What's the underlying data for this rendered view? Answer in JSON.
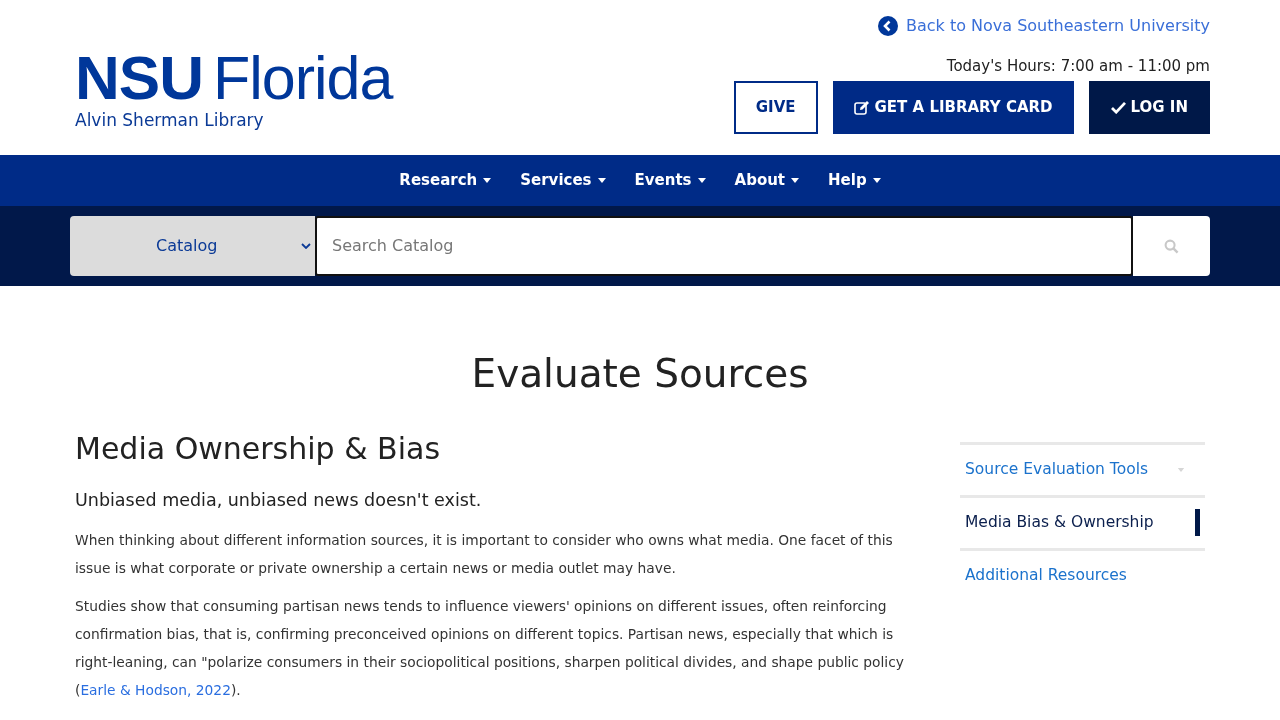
{
  "header": {
    "logo": {
      "primary": "NSU",
      "secondary": "Florida",
      "subtitle": "Alvin Sherman Library"
    },
    "back_link": "Back to Nova Southeastern University",
    "hours": "Today's Hours: 7:00 am - 11:00 pm",
    "buttons": [
      {
        "label": "GIVE",
        "kind": "outline"
      },
      {
        "label": "GET A LIBRARY CARD",
        "kind": "primary"
      },
      {
        "label": "LOG IN",
        "kind": "dark"
      }
    ]
  },
  "nav": {
    "items": [
      {
        "label": "Research"
      },
      {
        "label": "Services"
      },
      {
        "label": "Events"
      },
      {
        "label": "About"
      },
      {
        "label": "Help"
      }
    ]
  },
  "search": {
    "scope": "Catalog",
    "placeholder": "Search Catalog"
  },
  "page_title": "Evaluate Sources",
  "article": {
    "heading": "Media Ownership & Bias",
    "lead": "Unbiased media, unbiased news doesn't exist.",
    "paragraphs": [
      {
        "segments": [
          {
            "kind": "text",
            "text": "When thinking about different information sources, it is important to consider who owns what media. One facet of this issue is what corporate or private ownership a certain news or media outlet may have."
          }
        ]
      },
      {
        "segments": [
          {
            "kind": "text",
            "text": "Studies show that consuming partisan news tends to influence viewers' opinions on different issues, often reinforcing confirmation bias, that is, confirming preconceived opinions on different topics. Partisan news, especially that which is right-leaning, can \"polarize consumers in their sociopolitical positions, sharpen political divides, and shape public policy ("
          },
          {
            "kind": "link",
            "text": "Earle & Hodson, 2022"
          },
          {
            "kind": "text",
            "text": ")."
          }
        ]
      }
    ]
  },
  "side_nav": {
    "items": [
      {
        "label": "Source Evaluation Tools",
        "selected": false,
        "expandable": true
      },
      {
        "label": "Media Bias & Ownership",
        "selected": true,
        "expandable": false
      },
      {
        "label": "Additional Resources",
        "selected": false,
        "expandable": false
      }
    ]
  }
}
